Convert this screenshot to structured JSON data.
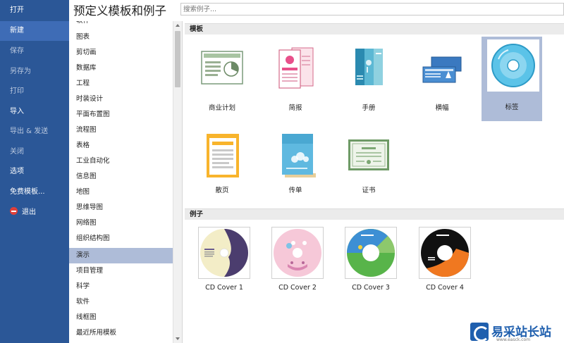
{
  "nav": {
    "items": [
      {
        "label": "打开"
      },
      {
        "label": "新建"
      },
      {
        "label": "保存"
      },
      {
        "label": "另存为"
      },
      {
        "label": "打印"
      },
      {
        "label": "导入"
      },
      {
        "label": "导出 & 发送"
      },
      {
        "label": "关闭"
      },
      {
        "label": "选项"
      },
      {
        "label": "免费模板..."
      },
      {
        "label": "退出"
      }
    ]
  },
  "header": {
    "title": "预定义模板和例子",
    "search_placeholder": "搜索例子..."
  },
  "categories": {
    "partial_top": "软件",
    "items": [
      {
        "label": "图表"
      },
      {
        "label": "剪切画"
      },
      {
        "label": "数据库"
      },
      {
        "label": "工程"
      },
      {
        "label": "时装设计"
      },
      {
        "label": "平面布置图"
      },
      {
        "label": "流程图"
      },
      {
        "label": "表格"
      },
      {
        "label": "工业自动化"
      },
      {
        "label": "信息图"
      },
      {
        "label": "地图"
      },
      {
        "label": "思维导图"
      },
      {
        "label": "网络图"
      },
      {
        "label": "组织结构图"
      },
      {
        "label": "演示"
      },
      {
        "label": "项目管理"
      },
      {
        "label": "科学"
      },
      {
        "label": "软件"
      },
      {
        "label": "线框图"
      },
      {
        "label": "最近所用模板"
      }
    ],
    "selected": "演示"
  },
  "templates": {
    "title": "模板",
    "items": [
      {
        "label": "商业计划",
        "icon": "business-plan-icon"
      },
      {
        "label": "简报",
        "icon": "brief-icon"
      },
      {
        "label": "手册",
        "icon": "brochure-icon"
      },
      {
        "label": "横幅",
        "icon": "banner-icon"
      },
      {
        "label": "标签",
        "icon": "cd-label-icon"
      },
      {
        "label": "散页",
        "icon": "flyer-icon"
      },
      {
        "label": "传单",
        "icon": "leaflet-icon"
      },
      {
        "label": "证书",
        "icon": "certificate-icon"
      }
    ],
    "selected": "标签"
  },
  "examples": {
    "title": "例子",
    "items": [
      {
        "label": "CD Cover 1"
      },
      {
        "label": "CD Cover 2"
      },
      {
        "label": "CD Cover 3"
      },
      {
        "label": "CD Cover 4"
      }
    ]
  },
  "watermark": {
    "text": "易采站长站",
    "sub": "www.easck.com"
  },
  "colors": {
    "nav_bg": "#2b5797",
    "nav_active": "#3e6cb6",
    "selection": "#aebcd8"
  }
}
